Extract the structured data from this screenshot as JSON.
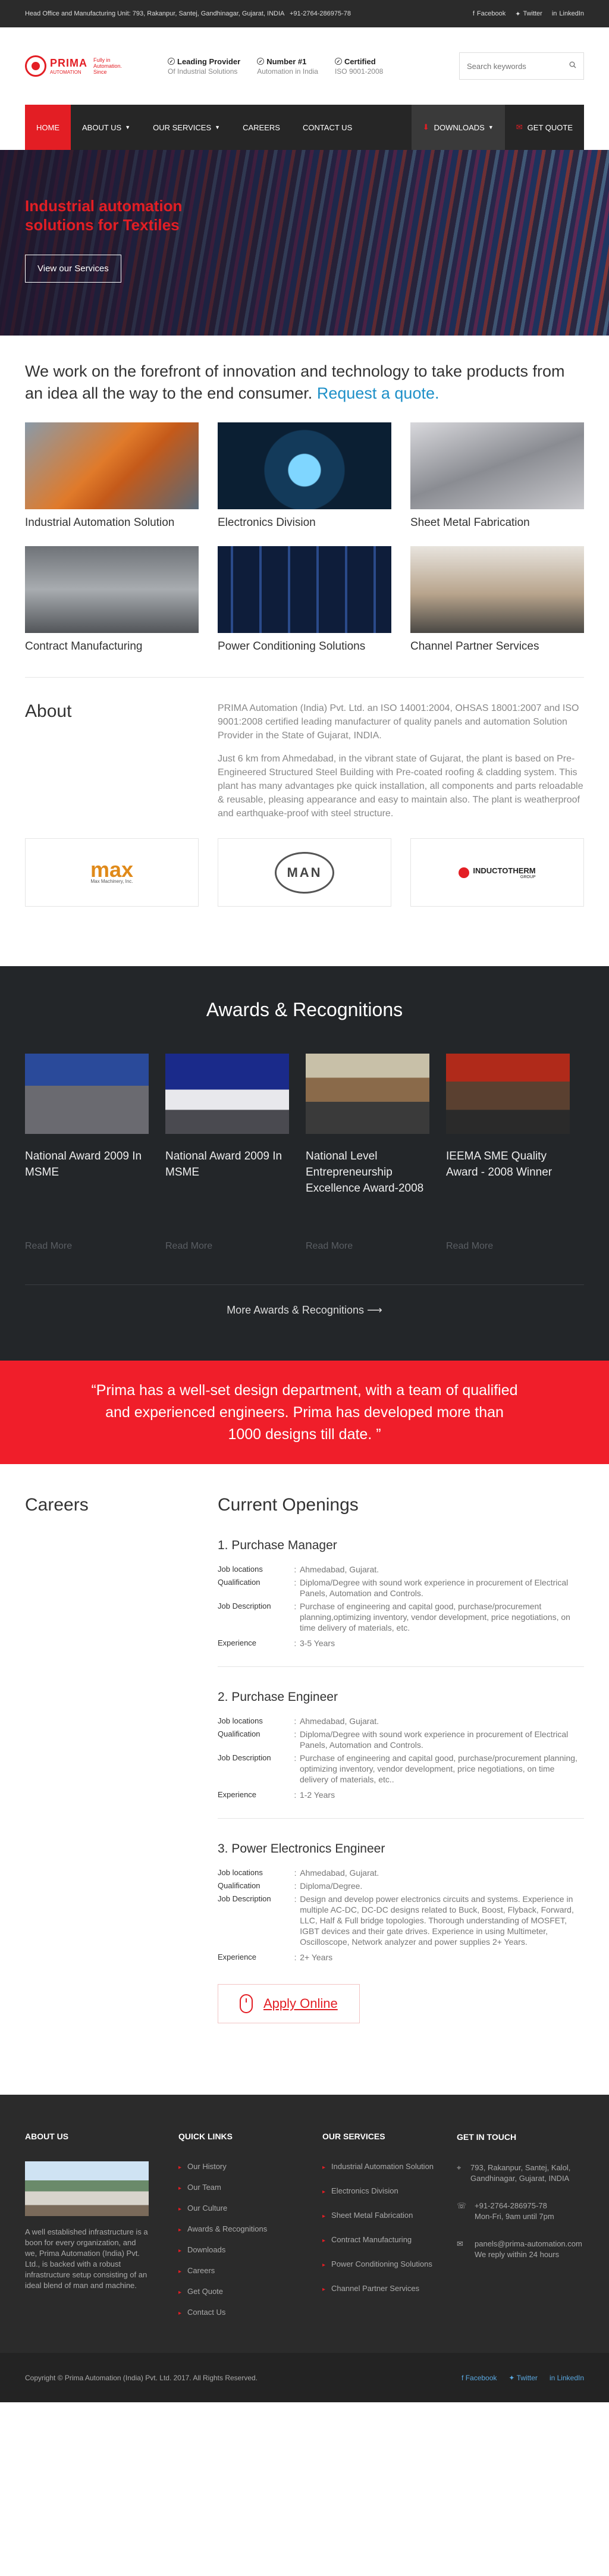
{
  "topbar": {
    "address": "Head Office and Manufacturing Unit: 793, Rakanpur, Santej, Gandhinagar, Gujarat, INDIA",
    "phone": "+91-2764-286975-78",
    "social": [
      "Facebook",
      "Twitter",
      "LinkedIn"
    ]
  },
  "header": {
    "logo_name": "PRIMA",
    "logo_sub": "AUTOMATION",
    "logo_tag": "Fully in Automation. Since",
    "badges": [
      {
        "title": "Leading Provider",
        "sub": "Of Industrial Solutions"
      },
      {
        "title": "Number #1",
        "sub": "Automation in India"
      },
      {
        "title": "Certified",
        "sub": "ISO 9001-2008"
      }
    ],
    "search_placeholder": "Search keywords"
  },
  "nav": {
    "items": [
      "HOME",
      "ABOUT US",
      "OUR SERVICES",
      "CAREERS",
      "CONTACT US"
    ],
    "downloads": "DOWNLOADS",
    "quote": "GET QUOTE"
  },
  "hero": {
    "title": "Industrial automation solutions for Textiles",
    "button": "View our Services"
  },
  "intro": {
    "text": "We work on the forefront of innovation and technology to take products from an idea all the way to the end consumer.",
    "link": "Request a quote."
  },
  "services": [
    "Industrial Automation Solution",
    "Electronics Division",
    "Sheet Metal Fabrication",
    "Contract Manufacturing",
    "Power Conditioning Solutions",
    "Channel Partner Services"
  ],
  "about": {
    "heading": "About",
    "p1": "PRIMA Automation (India) Pvt. Ltd. an ISO 14001:2004, OHSAS 18001:2007 and ISO 9001:2008 certified leading manufacturer of quality panels and automation Solution Provider in the State of Gujarat, INDIA.",
    "p2": "Just 6 km from Ahmedabad, in the vibrant state of Gujarat, the plant is based on Pre-Engineered Structured Steel Building with Pre-coated roofing & cladding system. This plant has many advantages pke quick installation, all components and parts reloadable & reusable, pleasing appearance and easy to maintain also. The plant is weatherproof and earthquake-proof with steel structure."
  },
  "clients": {
    "max": "max",
    "max_sub": "Max Machinery, Inc.",
    "man": "MAN",
    "inductotherm": "INDUCTOTHERM",
    "inductotherm_sub": "GROUP"
  },
  "awards": {
    "heading": "Awards & Recognitions",
    "items": [
      {
        "title": "National Award 2009 In MSME",
        "more": "Read More"
      },
      {
        "title": "National Award 2009 In MSME",
        "more": "Read More"
      },
      {
        "title": "National Level Entrepreneurship Excellence Award-2008",
        "more": "Read More"
      },
      {
        "title": "IEEMA SME Quality Award - 2008 Winner",
        "more": "Read More"
      }
    ],
    "more": "More Awards & Recognitions"
  },
  "quote": "“Prima has a well-set design department, with a team of qualified and experienced engineers. Prima has developed more than 1000 designs till date. ”",
  "careers": {
    "heading": "Careers",
    "openings": "Current Openings",
    "labels": {
      "loc": "Job locations",
      "qual": "Qualification",
      "desc": "Job Description",
      "exp": "Experience"
    },
    "jobs": [
      {
        "title": "1. Purchase Manager",
        "loc": "Ahmedabad, Gujarat.",
        "qual": "Diploma/Degree with sound work experience in procurement of Electrical Panels, Automation and Controls.",
        "desc": "Purchase of engineering and capital good, purchase/procurement planning,optimizing inventory, vendor development, price negotiations, on time delivery of materials, etc.",
        "exp": "3-5 Years"
      },
      {
        "title": "2. Purchase Engineer",
        "loc": "Ahmedabad, Gujarat.",
        "qual": "Diploma/Degree with sound work experience in procurement of Electrical Panels, Automation and Controls.",
        "desc": "Purchase of engineering and capital good, purchase/procurement planning, optimizing inventory, vendor development, price negotiations, on time delivery of materials, etc..",
        "exp": "1-2 Years"
      },
      {
        "title": "3. Power Electronics Engineer",
        "loc": "Ahmedabad, Gujarat.",
        "qual": "Diploma/Degree.",
        "desc": "Design and develop power electronics circuits and systems. Experience in multiple AC-DC, DC-DC designs related to Buck, Boost, Flyback, Forward, LLC, Half & Full bridge topologies. Thorough understanding of MOSFET, IGBT devices and their gate drives. Experience in using Multimeter, Oscilloscope, Network analyzer and power supplies 2+ Years.",
        "exp": "2+ Years"
      }
    ],
    "apply": "Apply Online"
  },
  "footer": {
    "about_heading": "ABOUT US",
    "about_text": "A well established infrastructure is a boon for every organization, and we, Prima Automation (India) Pvt. Ltd., is backed with a robust infrastructure setup consisting of an ideal blend of man and machine.",
    "links_heading": "QUICK LINKS",
    "links": [
      "Our History",
      "Our Team",
      "Our Culture",
      "Awards & Recognitions",
      "Downloads",
      "Careers",
      "Get Quote",
      "Contact Us"
    ],
    "services_heading": "OUR SERVICES",
    "services": [
      "Industrial Automation Solution",
      "Electronics Division",
      "Sheet Metal Fabrication",
      "Contract Manufacturing",
      "Power Conditioning Solutions",
      "Channel Partner Services"
    ],
    "contact_heading": "GET IN TOUCH",
    "address": "793, Rakanpur, Santej, Kalol, Gandhinagar, Gujarat, INDIA",
    "phone": "+91-2764-286975-78",
    "hours": "Mon-Fri, 9am until 7pm",
    "email": "panels@prima-automation.com",
    "reply": "We reply within 24 hours"
  },
  "bottom": {
    "copyright": "Copyright © Prima Automation (India) Pvt. Ltd. 2017. All Rights Reserved.",
    "social": [
      "Facebook",
      "Twitter",
      "LinkedIn"
    ]
  }
}
